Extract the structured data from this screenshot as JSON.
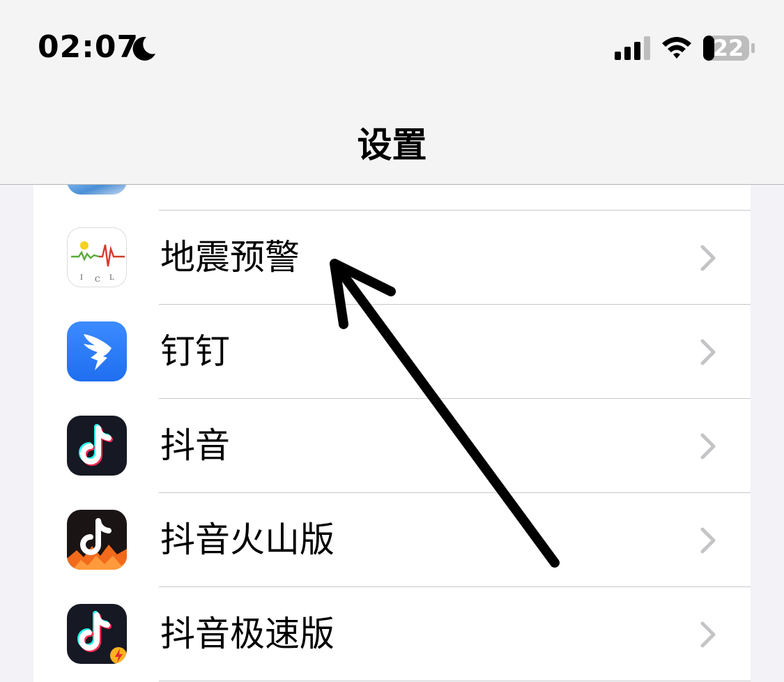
{
  "status_bar": {
    "time": "02:07",
    "battery_level": "22",
    "focus_icon": "moon-icon",
    "signal_icon": "cellular-signal-icon",
    "wifi_icon": "wifi-icon",
    "battery_icon": "battery-icon"
  },
  "nav": {
    "title": "设置"
  },
  "settings_list": {
    "items": [
      {
        "label": "地震预警",
        "icon": "earthquake-warning-app-icon"
      },
      {
        "label": "钉钉",
        "icon": "dingtalk-app-icon"
      },
      {
        "label": "抖音",
        "icon": "douyin-app-icon"
      },
      {
        "label": "抖音火山版",
        "icon": "douyin-huoshan-app-icon"
      },
      {
        "label": "抖音极速版",
        "icon": "douyin-lite-app-icon"
      }
    ]
  },
  "colors": {
    "background": "#f2f2f7",
    "cell": "#ffffff",
    "separator": "#c8c7cc",
    "chevron": "#c4c4c7",
    "dingtalk_blue": "#2f7cf6",
    "douyin_dark": "#161823",
    "annotation_arrow": "#000000"
  }
}
